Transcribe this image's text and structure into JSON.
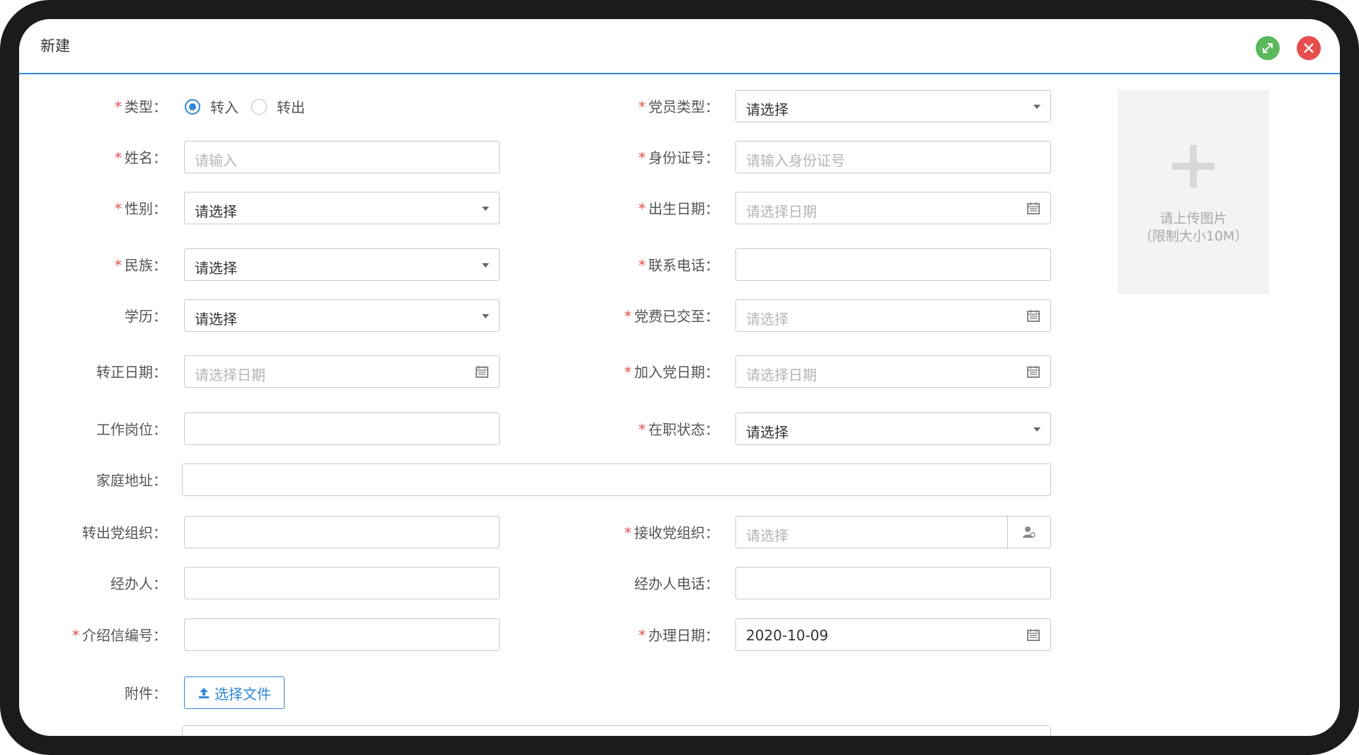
{
  "dialog": {
    "title": "新建"
  },
  "form": {
    "type": {
      "label": "类型：",
      "options": [
        "转入",
        "转出"
      ],
      "selected": "转入"
    },
    "member_type": {
      "label": "党员类型：",
      "value": "请选择"
    },
    "name": {
      "label": "姓名：",
      "placeholder": "请输入"
    },
    "id_number": {
      "label": "身份证号：",
      "placeholder": "请输入身份证号"
    },
    "gender": {
      "label": "性别：",
      "value": "请选择"
    },
    "birth_date": {
      "label": "出生日期：",
      "placeholder": "请选择日期"
    },
    "ethnicity": {
      "label": "民族：",
      "value": "请选择"
    },
    "phone": {
      "label": "联系电话：",
      "value": ""
    },
    "education": {
      "label": "学历：",
      "value": "请选择"
    },
    "fee_paid_until": {
      "label": "党费已交至：",
      "placeholder": "请选择"
    },
    "regular_date": {
      "label": "转正日期：",
      "placeholder": "请选择日期"
    },
    "join_date": {
      "label": "加入党日期：",
      "placeholder": "请选择日期"
    },
    "job_position": {
      "label": "工作岗位：",
      "value": ""
    },
    "job_status": {
      "label": "在职状态：",
      "value": "请选择"
    },
    "home_address": {
      "label": "家庭地址：",
      "value": ""
    },
    "out_org": {
      "label": "转出党组织：",
      "value": ""
    },
    "receive_org": {
      "label": "接收党组织：",
      "placeholder": "请选择"
    },
    "handler": {
      "label": "经办人：",
      "value": ""
    },
    "handler_phone": {
      "label": "经办人电话：",
      "value": ""
    },
    "letter_no": {
      "label": "介绍信编号：",
      "value": ""
    },
    "handle_date": {
      "label": "办理日期：",
      "value": "2020-10-09"
    },
    "attachment": {
      "label": "附件：",
      "button": "选择文件"
    }
  },
  "upload": {
    "line1": "请上传图片",
    "line2": "（限制大小10M）"
  },
  "required_mark": "*"
}
